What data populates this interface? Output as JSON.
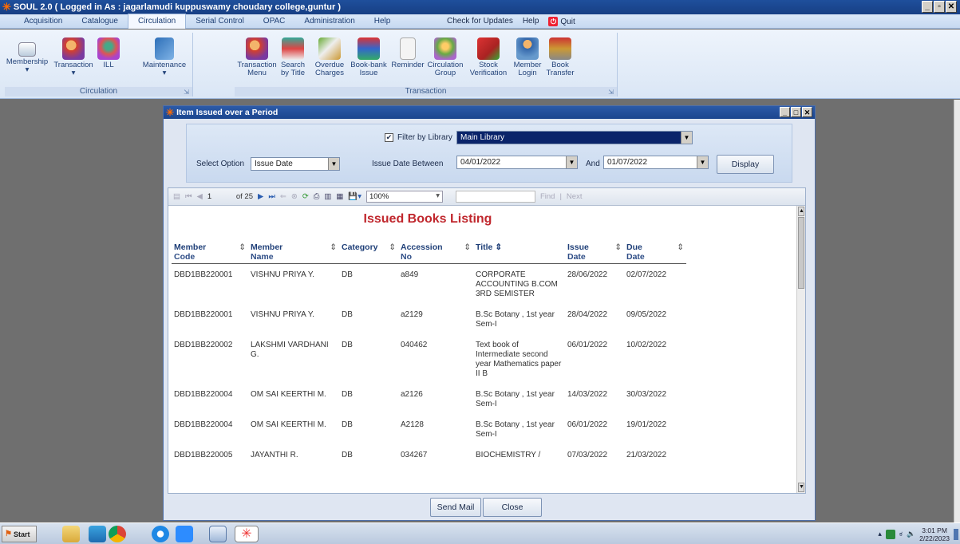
{
  "window": {
    "title": "SOUL 2.0 ( Logged in As : jagarlamudi kuppuswamy choudary college,guntur )"
  },
  "menu": {
    "tabs": [
      "Acquisition",
      "Catalogue",
      "Circulation",
      "Serial Control",
      "OPAC",
      "Administration",
      "Help"
    ],
    "active_tab": "Circulation",
    "extras": [
      "Check for Updates",
      "Help",
      "Quit"
    ]
  },
  "ribbon": {
    "circulation_group": {
      "label": "Circulation",
      "buttons": [
        "Membership",
        "Transaction",
        "ILL",
        "Maintenance"
      ]
    },
    "transaction_group": {
      "label": "Transaction",
      "buttons": [
        [
          "Transaction",
          "Menu"
        ],
        [
          "Search",
          "by Title"
        ],
        [
          "Overdue",
          "Charges"
        ],
        [
          "Book-bank",
          "Issue"
        ],
        [
          "Reminder",
          ""
        ],
        [
          "Circulation",
          "Group"
        ],
        [
          "Stock",
          "Verification"
        ],
        [
          "Member",
          "Login"
        ],
        [
          "Book",
          "Transfer"
        ]
      ]
    }
  },
  "dialog": {
    "title": "Item Issued over a Period",
    "filter_label": "Filter by Library",
    "library_value": "Main Library",
    "select_option_label": "Select Option",
    "select_option_value": "Issue Date",
    "between_label": "Issue Date Between",
    "from_date": "04/01/2022",
    "and_label": "And",
    "to_date": "01/07/2022",
    "display_button": "Display",
    "send_mail_button": "Send Mail",
    "close_button": "Close"
  },
  "report": {
    "toolbar": {
      "page_current": "1",
      "page_of": "of 25",
      "zoom": "100%",
      "find": "Find",
      "next": "Next"
    },
    "title": "Issued Books Listing",
    "columns": [
      [
        "Member",
        "Code"
      ],
      [
        "Member",
        "Name"
      ],
      [
        "Category",
        ""
      ],
      [
        "Accession",
        "No"
      ],
      [
        "Title",
        ""
      ],
      [
        "Issue",
        "Date"
      ],
      [
        "Due",
        "Date"
      ]
    ],
    "rows": [
      [
        "DBD1BB220001",
        "VISHNU PRIYA Y.",
        "DB",
        "a849",
        "CORPORATE ACCOUNTING B.COM 3RD SEMISTER",
        "28/06/2022",
        "02/07/2022"
      ],
      [
        "DBD1BB220001",
        "VISHNU PRIYA Y.",
        "DB",
        "a2129",
        "B.Sc Botany , 1st year Sem-I",
        "28/04/2022",
        "09/05/2022"
      ],
      [
        "DBD1BB220002",
        "LAKSHMI VARDHANI G.",
        "DB",
        "040462",
        "Text book of Intermediate second year Mathematics paper II B",
        "06/01/2022",
        "10/02/2022"
      ],
      [
        "DBD1BB220004",
        "OM SAI KEERTHI M.",
        "DB",
        "a2126",
        "B.Sc Botany , 1st year Sem-I",
        "14/03/2022",
        "30/03/2022"
      ],
      [
        "DBD1BB220004",
        "OM SAI KEERTHI M.",
        "DB",
        "A2128",
        "B.Sc Botany , 1st year Sem-I",
        "06/01/2022",
        "19/01/2022"
      ],
      [
        "DBD1BB220005",
        "JAYANTHI R.",
        "DB",
        "034267",
        "BIOCHEMISTRY /",
        "07/03/2022",
        "21/03/2022"
      ]
    ]
  },
  "taskbar": {
    "start": "Start",
    "time": "3:01 PM",
    "date": "2/22/2023"
  },
  "colors": {
    "title_blue": "#1f4f9c",
    "report_title_red": "#c0272d",
    "column_header_blue": "#1f3f78",
    "selected_blue": "#0a246a"
  }
}
